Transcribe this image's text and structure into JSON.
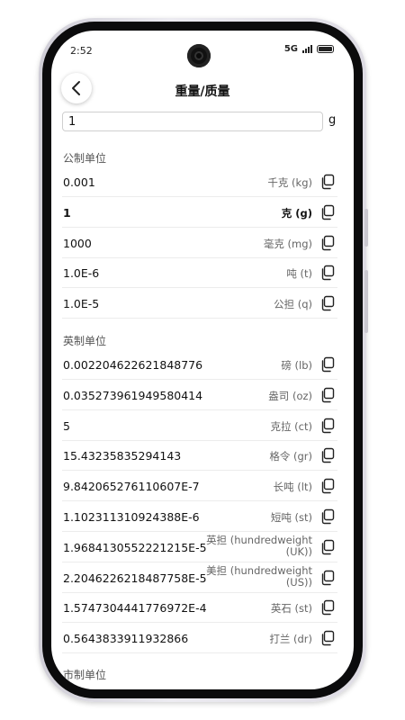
{
  "status": {
    "time": "2:52",
    "network": "5G"
  },
  "header": {
    "title": "重量/质量"
  },
  "input": {
    "value": "1",
    "unit": "g"
  },
  "sections": {
    "metric": "公制单位",
    "imperial": "英制单位",
    "chinese": "市制单位"
  },
  "metric_rows": [
    {
      "value": "0.001",
      "unit": "千克 (kg)"
    },
    {
      "value": "1",
      "unit": "克 (g)"
    },
    {
      "value": "1000",
      "unit": "毫克 (mg)"
    },
    {
      "value": "1.0E-6",
      "unit": "吨 (t)"
    },
    {
      "value": "1.0E-5",
      "unit": "公担 (q)"
    }
  ],
  "imperial_rows": [
    {
      "value": "0.002204622621848776",
      "unit": "磅 (lb)"
    },
    {
      "value": "0.035273961949580414",
      "unit": "盎司 (oz)"
    },
    {
      "value": "5",
      "unit": "克拉 (ct)"
    },
    {
      "value": "15.43235835294143",
      "unit": "格令 (gr)"
    },
    {
      "value": "9.842065276110607E-7",
      "unit": "长吨 (lt)"
    },
    {
      "value": "1.102311310924388E-6",
      "unit": "短吨 (st)"
    },
    {
      "value": "1.9684130552221215E-5",
      "unit": "英担 (hundredweight (UK))"
    },
    {
      "value": "2.2046226218487758E-5",
      "unit": "美担 (hundredweight (US))"
    },
    {
      "value": "1.5747304441776972E-4",
      "unit": "英石 (st)"
    },
    {
      "value": "0.5643833911932866",
      "unit": "打兰 (dr)"
    }
  ],
  "icons": {
    "back": "chevron-left-icon",
    "copy": "copy-icon"
  }
}
